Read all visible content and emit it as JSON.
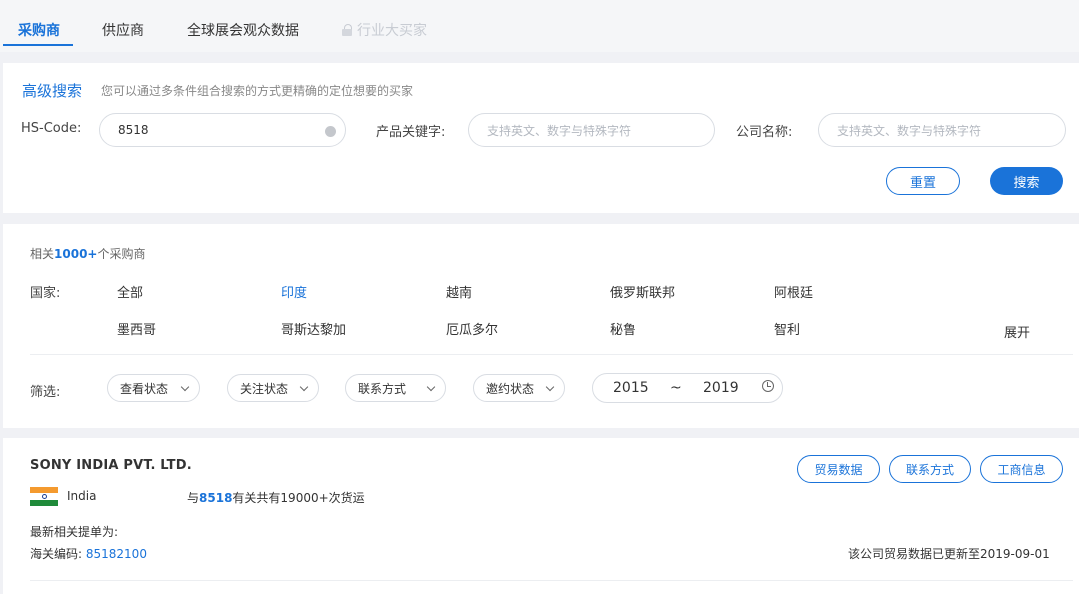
{
  "tabs": [
    {
      "label": "采购商",
      "active": true
    },
    {
      "label": "供应商"
    },
    {
      "label": "全球展会观众数据"
    },
    {
      "label": "行业大买家",
      "locked": true
    }
  ],
  "advanced_search": {
    "title": "高级搜索",
    "description": "您可以通过多条件组合搜索的方式更精确的定位想要的买家",
    "hs_code_label": "HS-Code:",
    "hs_code_value": "8518",
    "keyword_label": "产品关键字:",
    "keyword_placeholder": "支持英文、数字与特殊字符",
    "company_label": "公司名称:",
    "company_placeholder": "支持英文、数字与特殊字符",
    "reset_label": "重置",
    "search_label": "搜索"
  },
  "results_summary": {
    "prefix": "相关",
    "count": "1000+",
    "suffix": "个采购商"
  },
  "country_filter": {
    "label": "国家:",
    "row1": [
      "全部",
      "印度",
      "越南",
      "俄罗斯联邦",
      "阿根廷"
    ],
    "row2": [
      "墨西哥",
      "哥斯达黎加",
      "厄瓜多尔",
      "秘鲁",
      "智利"
    ],
    "selected": "印度",
    "expand_label": "展开"
  },
  "filters": {
    "label": "筛选:",
    "dropdowns": [
      "查看状态",
      "关注状态",
      "联系方式",
      "邀约状态"
    ],
    "date_from": "2015",
    "date_sep": "~",
    "date_to": "2019"
  },
  "result": {
    "company_name": "SONY INDIA PVT. LTD.",
    "country": "India",
    "shipments_prefix": "与",
    "shipments_code": "8518",
    "shipments_suffix": "有关共有19000+次货运",
    "latest_label": "最新相关提单为:",
    "hs_label": "海关编码:",
    "hs_value": "85182100",
    "updated_text": "该公司贸易数据已更新至2019-09-01",
    "buttons": [
      "贸易数据",
      "联系方式",
      "工商信息"
    ]
  },
  "colors": {
    "accent": "#1a73d9",
    "background": "#f0f1f5"
  }
}
